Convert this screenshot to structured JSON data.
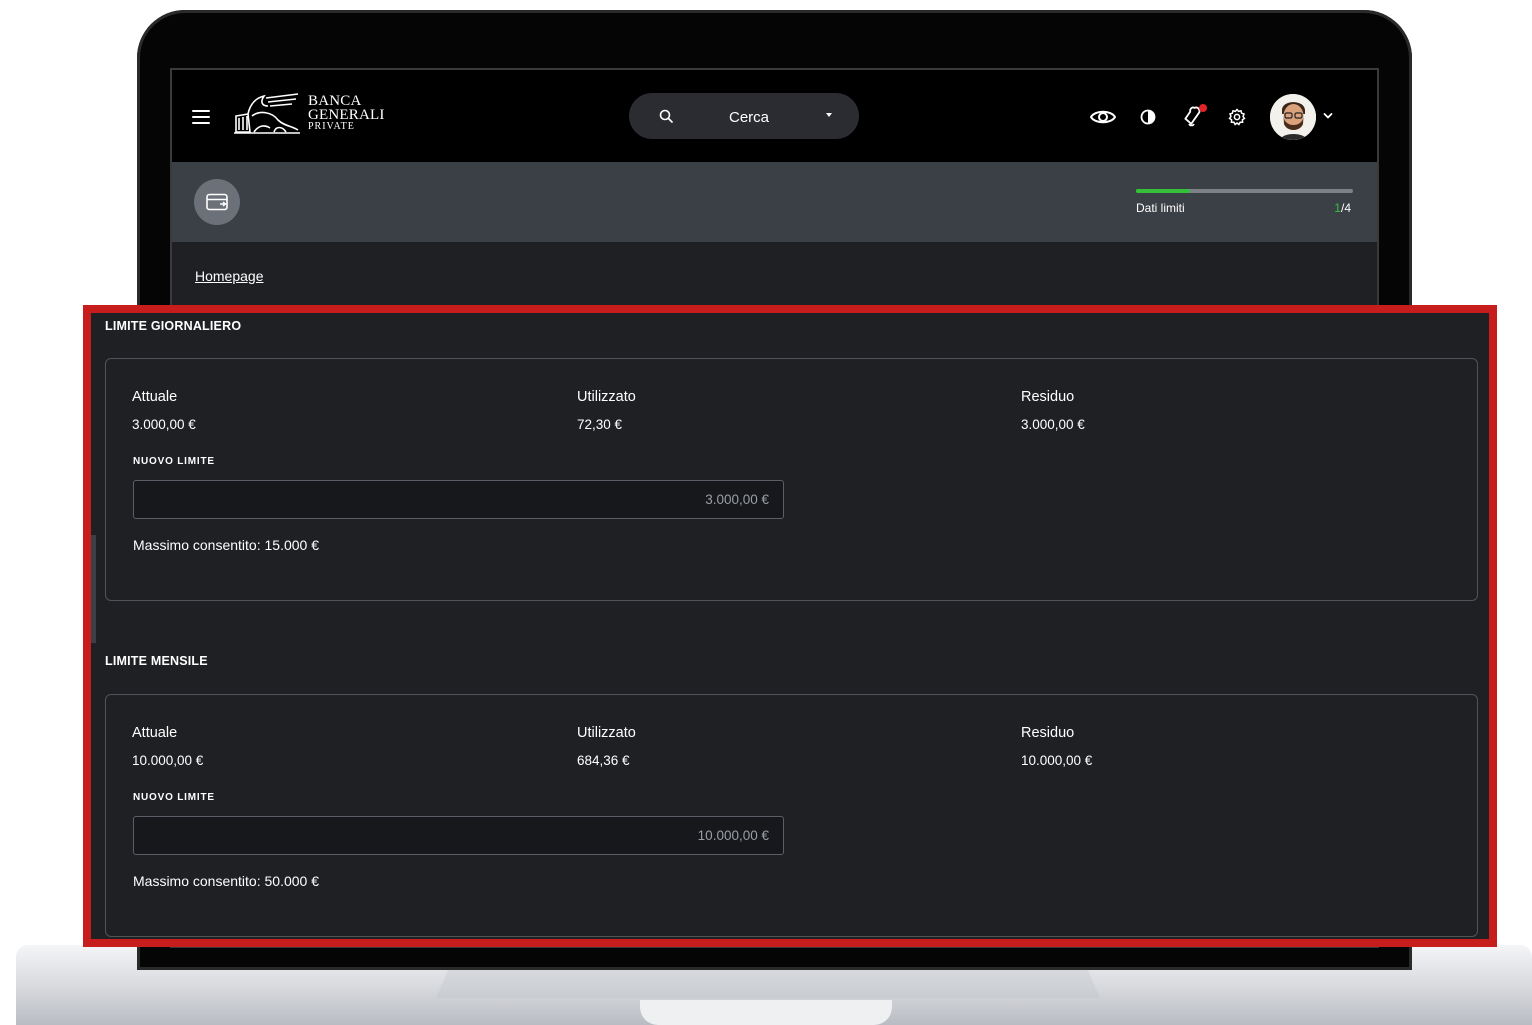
{
  "brand": {
    "line1": "BANCA",
    "line2": "GENERALI",
    "line3": "PRIVATE"
  },
  "search": {
    "label": "Cerca"
  },
  "progress": {
    "label": "Dati limiti",
    "current": "1",
    "total": "/4",
    "fraction": 0.25
  },
  "breadcrumb": {
    "home": "Homepage"
  },
  "colors": {
    "accent_green": "#34c038",
    "highlight_red": "#c81d1d",
    "background": "#1f2024"
  },
  "daily": {
    "title": "LIMITE GIORNALIERO",
    "current_label": "Attuale",
    "current_value": "3.000,00 €",
    "used_label": "Utilizzato",
    "used_value": "72,30 €",
    "remaining_label": "Residuo",
    "remaining_value": "3.000,00 €",
    "new_limit_label": "NUOVO LIMITE",
    "new_limit_placeholder": "3.000,00 €",
    "max_text": "Massimo consentito: 15.000 €"
  },
  "monthly": {
    "title": "LIMITE MENSILE",
    "current_label": "Attuale",
    "current_value": "10.000,00 €",
    "used_label": "Utilizzato",
    "used_value": "684,36 €",
    "remaining_label": "Residuo",
    "remaining_value": "10.000,00 €",
    "new_limit_label": "NUOVO LIMITE",
    "new_limit_placeholder": "10.000,00 €",
    "max_text": "Massimo consentito: 50.000 €"
  },
  "icons": {
    "menu": "hamburger-icon",
    "search": "search-icon",
    "caret": "caret-down-icon",
    "visibility": "eye-icon",
    "contrast": "contrast-icon",
    "notifications": "bell-icon",
    "settings": "gear-icon",
    "card": "credit-card-icon"
  }
}
